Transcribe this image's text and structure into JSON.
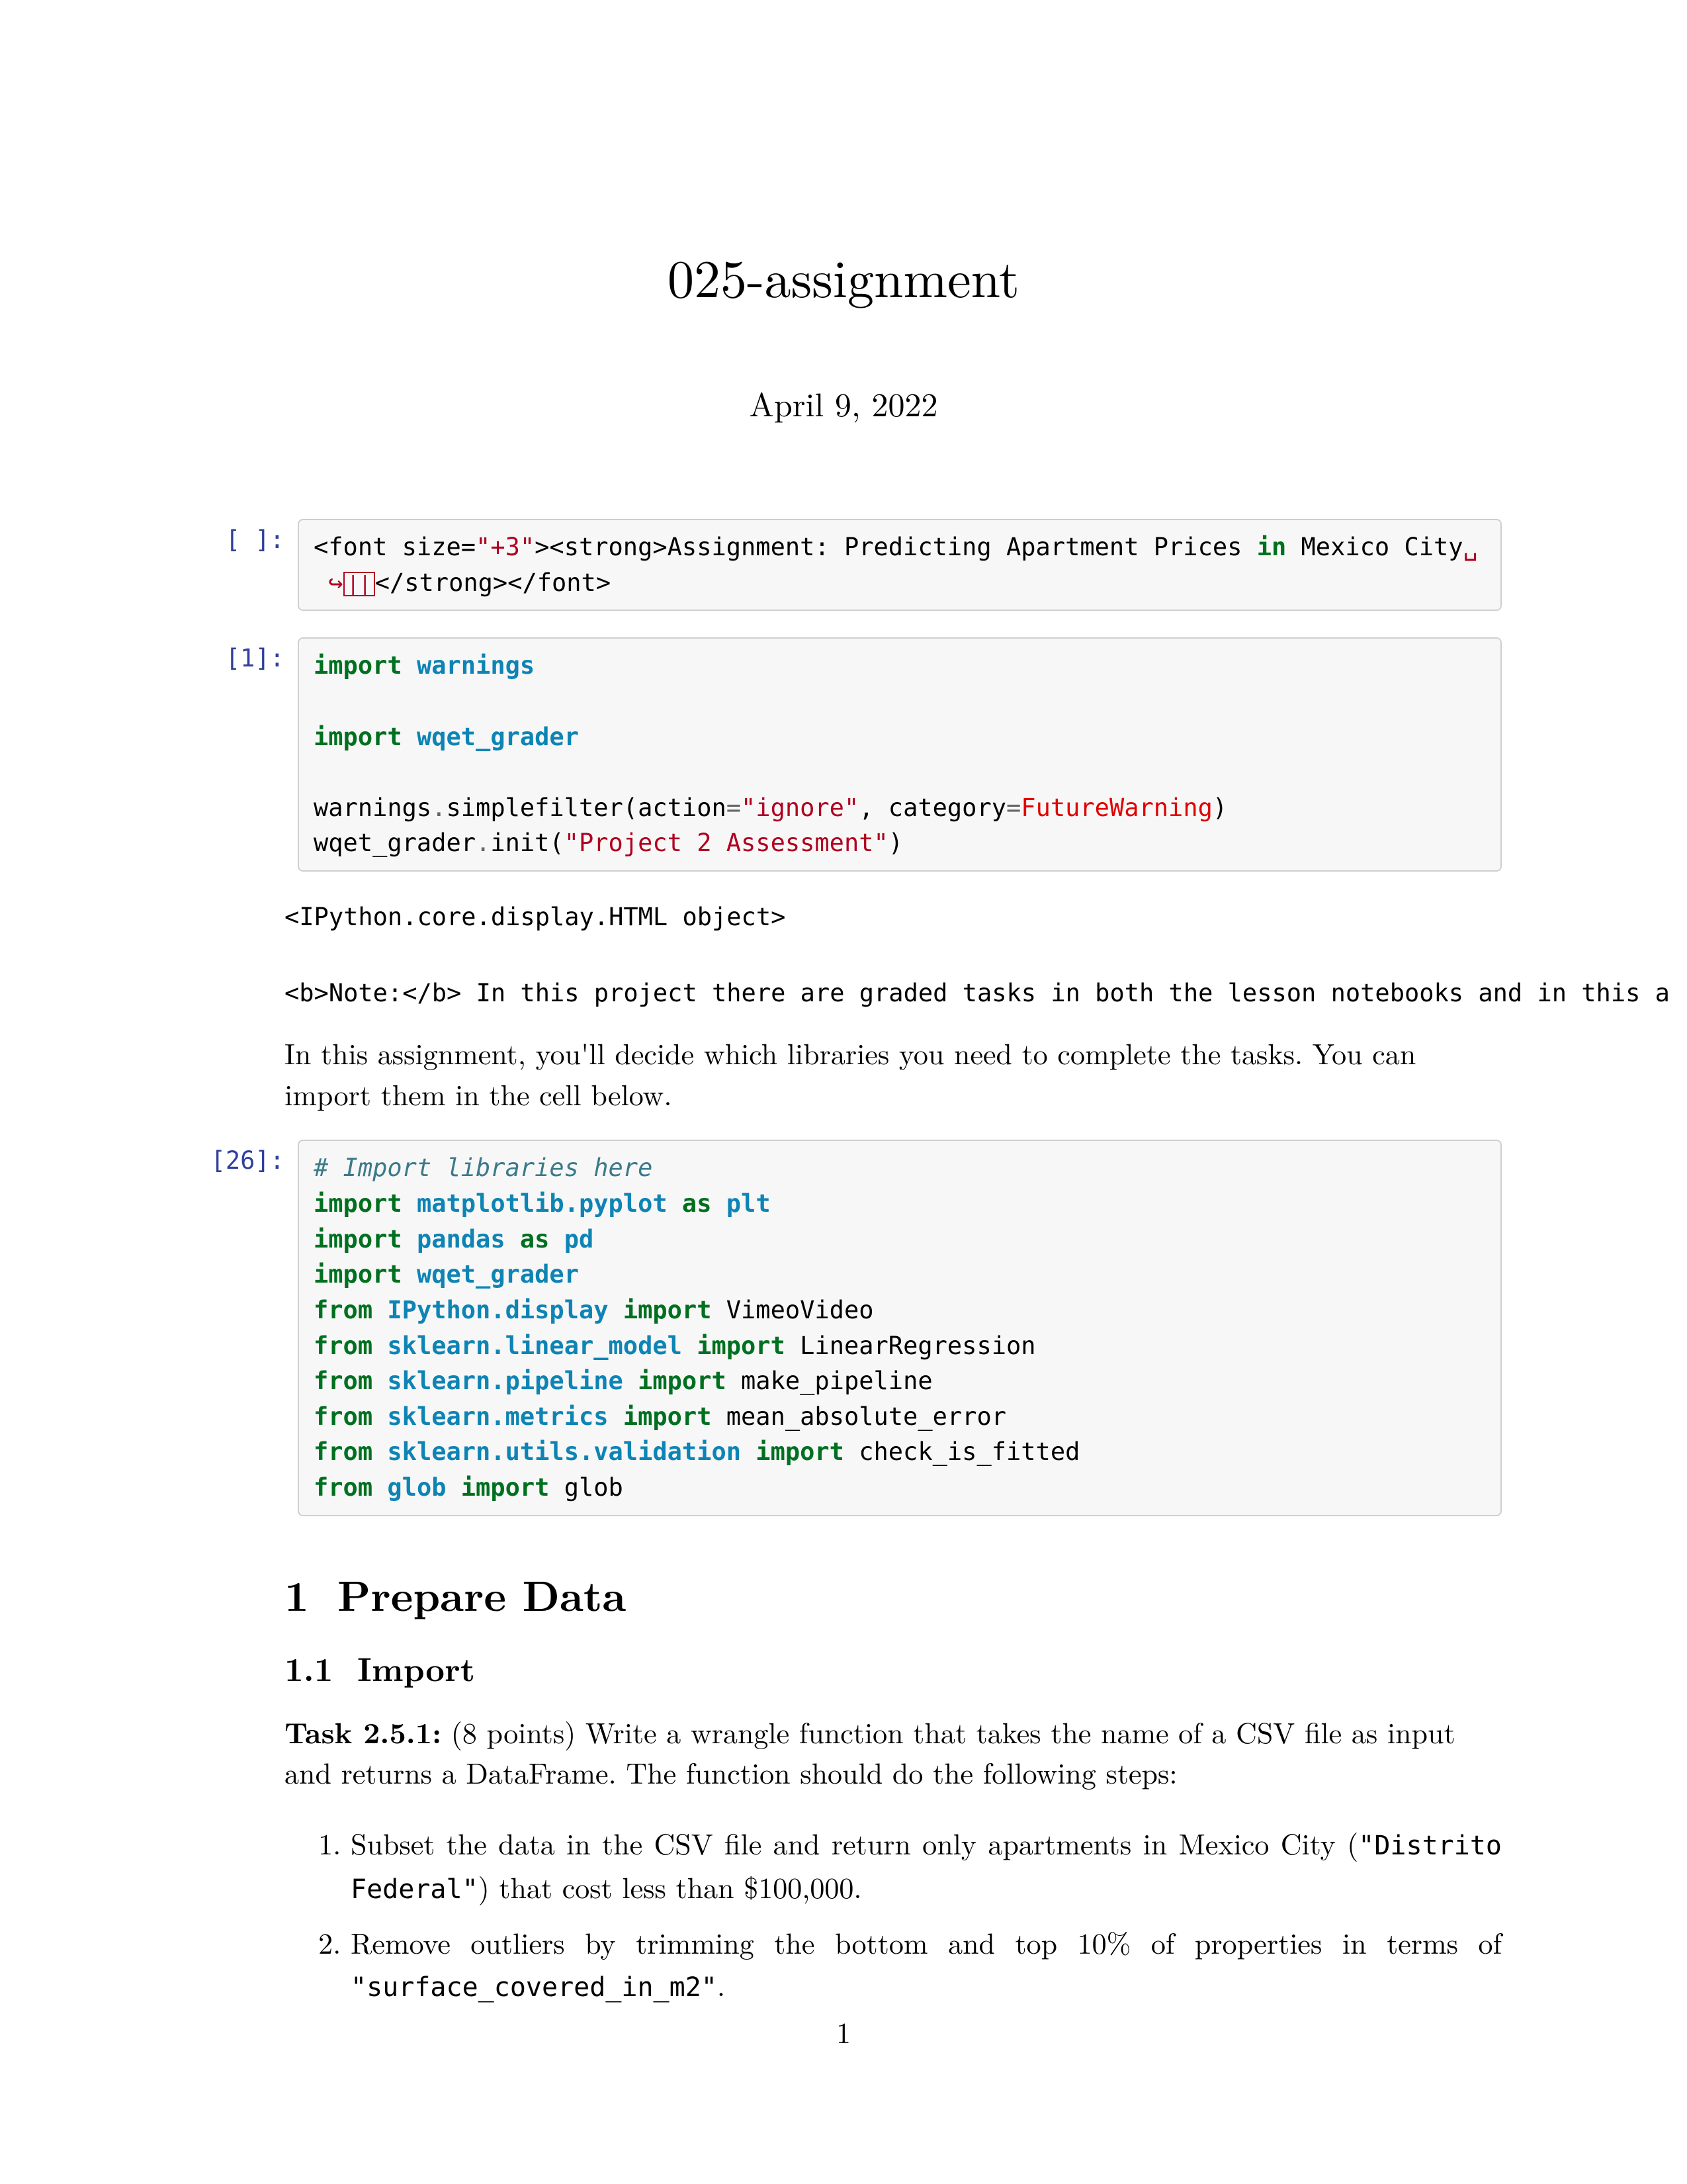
{
  "title": "025-assignment",
  "date": "April 9, 2022",
  "page_number": "1",
  "cells": {
    "c0": {
      "prompt": "[ ]:",
      "line1_pre": "<font size=",
      "line1_str": "\"+3\"",
      "line1_mid": "><strong>Assignment: Predicting Apartment Prices ",
      "line1_kw": "in",
      "line1_post": " Mexico City",
      "line1_wrap": "␣",
      "line2_arrow": "↪",
      "line2_box": "||",
      "line2_rest": "</strong></font>"
    },
    "c1": {
      "prompt": "[1]:",
      "l1a": "import",
      "l1b": "warnings",
      "l2a": "import",
      "l2b": "wqet_grader",
      "l3a": "warnings",
      "l3b": ".",
      "l3c": "simplefilter(action",
      "l3d": "=",
      "l3e": "\"ignore\"",
      "l3f": ", category",
      "l3g": "=",
      "l3h": "FutureWarning",
      "l3i": ")",
      "l4a": "wqet_grader",
      "l4b": ".",
      "l4c": "init(",
      "l4d": "\"Project 2 Assessment\"",
      "l4e": ")"
    },
    "out1": {
      "line1": "<IPython.core.display.HTML object>",
      "line2": "<b>Note:</b> In this project there are graded tasks in both the lesson notebooks and in this a"
    },
    "body1": "In this assignment, you'll decide which libraries you need to complete the tasks. You can import them in the cell below.",
    "c26": {
      "prompt": "[26]:",
      "comment": "# Import libraries here",
      "l1a": "import",
      "l1b": "matplotlib.pyplot",
      "l1c": "as",
      "l1d": "plt",
      "l2a": "import",
      "l2b": "pandas",
      "l2c": "as",
      "l2d": "pd",
      "l3a": "import",
      "l3b": "wqet_grader",
      "l4a": "from",
      "l4b": "IPython.display",
      "l4c": "import",
      "l4d": "VimeoVideo",
      "l5a": "from",
      "l5b": "sklearn.linear_model",
      "l5c": "import",
      "l5d": "LinearRegression",
      "l6a": "from",
      "l6b": "sklearn.pipeline",
      "l6c": "import",
      "l6d": "make_pipeline",
      "l7a": "from",
      "l7b": "sklearn.metrics",
      "l7c": "import",
      "l7d": "mean_absolute_error",
      "l8a": "from",
      "l8b": "sklearn.utils.validation",
      "l8c": "import",
      "l8d": "check_is_fitted",
      "l9a": "from",
      "l9b": "glob",
      "l9c": "import",
      "l9d": "glob"
    }
  },
  "section": {
    "num": "1",
    "title": "Prepare Data"
  },
  "subsection": {
    "num": "1.1",
    "title": "Import"
  },
  "task": {
    "label": "Task 2.5.1:",
    "points": " (8 points) Write a ",
    "fn": "wrangle",
    "rest": " function that takes the name of a CSV file as input and returns a DataFrame. The function should do the following steps:"
  },
  "steps": {
    "s1a": "Subset the data in the CSV file and return only apartments in Mexico City (",
    "s1b": "\"Distrito Federal\"",
    "s1c": ") that cost less than $100,000.",
    "s2a": "Remove outliers by trimming the bottom and top 10% of properties in terms of ",
    "s2b": "\"surface_covered_in_m2\"",
    "s2c": "."
  }
}
